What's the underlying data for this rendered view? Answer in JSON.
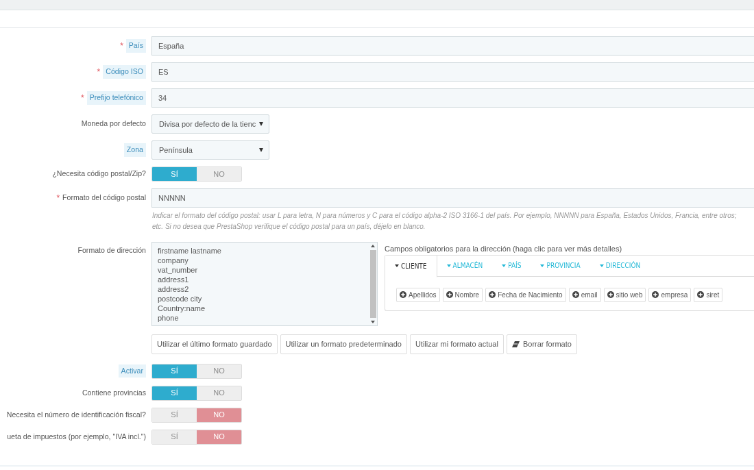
{
  "fields": [
    {
      "kind": "text",
      "label": {
        "text": "País",
        "required_mark": "*",
        "hint": true
      },
      "value": "España"
    },
    {
      "kind": "text",
      "label": {
        "text": "Código ISO",
        "required_mark": "*",
        "hint": true
      },
      "value": "ES"
    },
    {
      "kind": "text",
      "label": {
        "text": "Prefijo telefónico",
        "required_mark": "*",
        "hint": true
      },
      "value": "34"
    },
    {
      "kind": "select",
      "label": {
        "text": "Moneda por defecto",
        "hint": false
      },
      "value": "Divisa por defecto de la tienc"
    },
    {
      "kind": "select",
      "label": {
        "text": "Zona",
        "hint": true
      },
      "value": "Península"
    },
    {
      "kind": "toggle",
      "label": {
        "text": "¿Necesita código postal/Zip?",
        "hint": false
      },
      "on": true,
      "on_text": "SÍ",
      "off_text": "NO"
    },
    {
      "kind": "text",
      "label": {
        "text": "Formato del código postal",
        "required_mark": "*",
        "hint": false
      },
      "value": "NNNNN",
      "help": [
        "Indicar el formato del código postal: usar L para letra, N para números y C para el código alpha-2 ISO 3166-1 del país. Por ejemplo, NNNNN para España, Estados Unidos, Francia, entre otros;",
        "etc. Si no desea que PrestaShop verifique el código postal para un país, déjelo en blanco."
      ]
    },
    {
      "kind": "address",
      "label": {
        "text": "Formato de dirección",
        "hint": false
      },
      "lines": [
        "firstname lastname",
        "company",
        "vat_number",
        "address1",
        "address2",
        "postcode city",
        "Country:name",
        "phone"
      ],
      "panel_title": "Campos obligatorios para la dirección (haga clic para ver más detalles)",
      "tabs": [
        {
          "label": "CLIENTE",
          "selected": true
        },
        {
          "label": "ALMACÉN",
          "selected": false
        },
        {
          "label": "PAÍS",
          "selected": false
        },
        {
          "label": "PROVINCIA",
          "selected": false
        },
        {
          "label": "DIRECCIÓN",
          "selected": false
        }
      ],
      "chips": [
        "Apellidos",
        "Nombre",
        "Fecha de Nacimiento",
        "email",
        "sitio web",
        "empresa",
        "siret"
      ],
      "buttons": [
        {
          "label": "Utilizar el último formato guardado"
        },
        {
          "label": "Utilizar un formato predeterminado"
        },
        {
          "label": "Utilizar mi formato actual"
        },
        {
          "label": "Borrar formato",
          "kind": "clear"
        }
      ]
    },
    {
      "kind": "toggle",
      "label": {
        "text": "Activar",
        "hint": true
      },
      "on": true,
      "on_text": "SÍ",
      "off_text": "NO"
    },
    {
      "kind": "toggle",
      "label": {
        "text": "Contiene provincias",
        "hint": false
      },
      "on": true,
      "on_text": "SÍ",
      "off_text": "NO"
    },
    {
      "kind": "toggle",
      "label": {
        "text": "Necesita el número de identificación fiscal?",
        "hint": false
      },
      "on": false,
      "on_text": "SÍ",
      "off_text": "NO"
    },
    {
      "kind": "toggle",
      "label": {
        "text": "ueta de impuestos (por ejemplo, \"IVA incl.\")",
        "hint": false
      },
      "on": false,
      "on_text": "SÍ",
      "off_text": "NO"
    }
  ]
}
